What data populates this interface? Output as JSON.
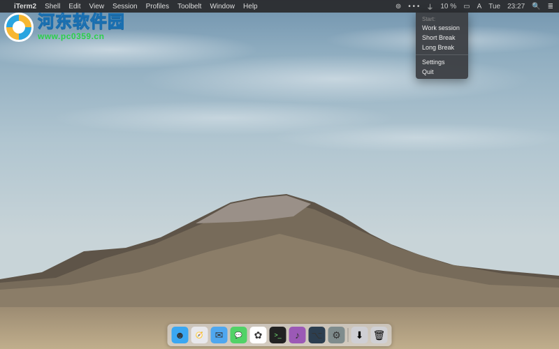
{
  "menubar": {
    "app_name": "iTerm2",
    "items": [
      "Shell",
      "Edit",
      "View",
      "Session",
      "Profiles",
      "Toolbelt",
      "Window",
      "Help"
    ],
    "right": {
      "wifi": "10 %",
      "day": "Tue",
      "time": "23:27"
    }
  },
  "dropdown": {
    "header": "Start:",
    "start_items": [
      "Work session",
      "Short Break",
      "Long Break"
    ],
    "bottom_items": [
      "Settings",
      "Quit"
    ]
  },
  "watermark": {
    "title": "河东软件园",
    "url": "www.pc0359.cn"
  },
  "dock": {
    "items": [
      {
        "name": "finder",
        "bg": "#3aa7f2",
        "glyph": "☻"
      },
      {
        "name": "safari",
        "bg": "#e8e8ec",
        "glyph": "🧭"
      },
      {
        "name": "mail",
        "bg": "#4fa7ef",
        "glyph": "✉"
      },
      {
        "name": "messages",
        "bg": "#51d267",
        "glyph": "💬"
      },
      {
        "name": "photos",
        "bg": "#ffffff",
        "glyph": "✿"
      },
      {
        "name": "terminal",
        "bg": "#222222",
        "glyph": ">_"
      },
      {
        "name": "app1",
        "bg": "#9b59b6",
        "glyph": "♪"
      },
      {
        "name": "app2",
        "bg": "#2c3e50",
        "glyph": "⌥"
      },
      {
        "name": "settings",
        "bg": "#7f8c8d",
        "glyph": "⚙"
      }
    ],
    "extras": [
      {
        "name": "downloads",
        "bg": "#cfcfd4",
        "glyph": "⬇"
      },
      {
        "name": "trash",
        "bg": "#d0d0d4",
        "glyph": "🗑"
      }
    ]
  }
}
